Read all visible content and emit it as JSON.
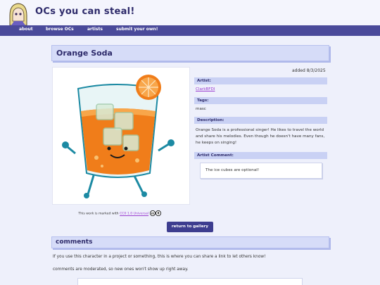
{
  "header": {
    "site_title": "OCs you can steal!"
  },
  "nav": {
    "items": [
      {
        "label": "about"
      },
      {
        "label": "browse OCs"
      },
      {
        "label": "artists"
      },
      {
        "label": "submit your own!"
      }
    ]
  },
  "oc": {
    "title": "Orange Soda",
    "added": "added 8/3/2025",
    "artist_label": "Artist:",
    "artist": "ClarkBFDI",
    "tags_label": "Tags:",
    "tags": "masc",
    "description_label": "Description:",
    "description": "Orange Soda is a professional singer! He likes to travel the world and share his melodies. Even though he doesn't have many fans, he keeps on singing!",
    "artist_comment_label": "Artist Comment:",
    "artist_comment": "The ice cubes are optional!"
  },
  "license": {
    "prefix": "This work is marked with",
    "link": "CC0 1.0 Universal"
  },
  "return_button": "return to gallery",
  "comments": {
    "title": "comments",
    "line1": "If you use this character in a project or something, this is where you can share a link to let others know!",
    "line2": "comments are moderated, so new ones won't show up right away."
  },
  "colors": {
    "accent": "#4a4a9a",
    "panel": "#d6dcf8",
    "link": "#9b3fd0",
    "soda": "#f07d1a"
  }
}
